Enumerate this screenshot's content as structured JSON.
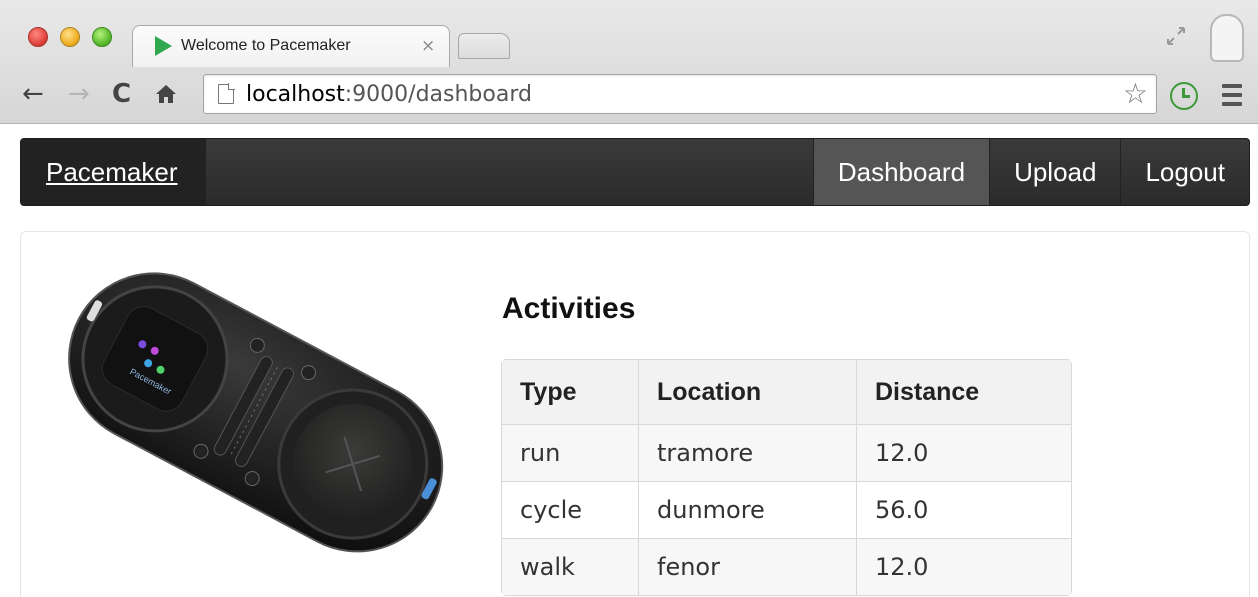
{
  "browser": {
    "tab_title": "Welcome to Pacemaker",
    "tab_close": "×",
    "url_host": "localhost",
    "url_rest": ":9000/dashboard"
  },
  "navbar": {
    "brand": "Pacemaker",
    "items": [
      {
        "label": "Dashboard",
        "active": true
      },
      {
        "label": "Upload",
        "active": false
      },
      {
        "label": "Logout",
        "active": false
      }
    ]
  },
  "main": {
    "heading": "Activities",
    "table": {
      "columns": [
        "Type",
        "Location",
        "Distance"
      ],
      "rows": [
        [
          "run",
          "tramore",
          "12.0"
        ],
        [
          "cycle",
          "dunmore",
          "56.0"
        ],
        [
          "walk",
          "fenor",
          "12.0"
        ]
      ]
    },
    "device_label": "Pacemaker"
  },
  "colors": {
    "navbar_bg": "#2b2b2b",
    "active_nav": "#555555",
    "favicon": "#2fa84f",
    "history_icon": "#3a9a3a"
  },
  "icons": [
    "back-arrow-icon",
    "forward-arrow-icon",
    "reload-icon",
    "home-icon",
    "page-icon",
    "star-icon",
    "history-clock-icon",
    "menu-icon",
    "fullscreen-icon",
    "profile-icon"
  ]
}
